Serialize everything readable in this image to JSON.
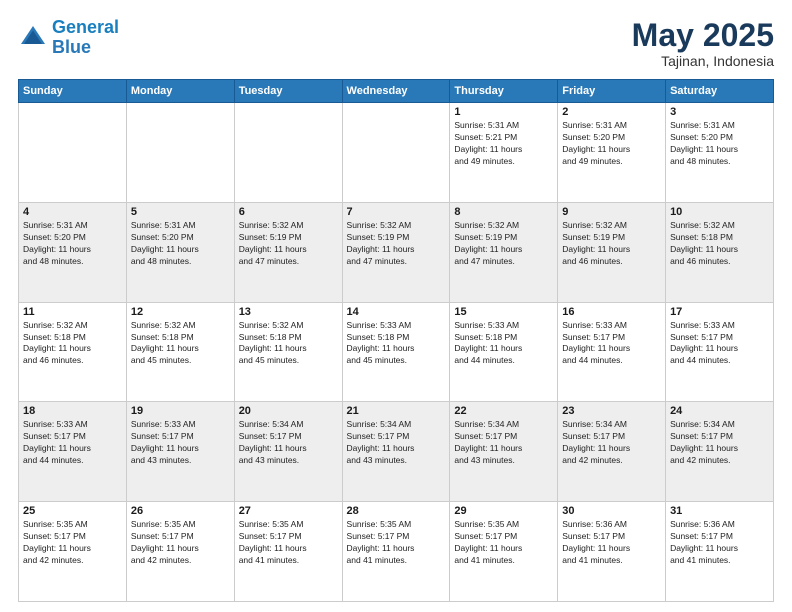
{
  "header": {
    "logo_general": "General",
    "logo_blue": "Blue",
    "month_title": "May 2025",
    "subtitle": "Tajinan, Indonesia"
  },
  "days_of_week": [
    "Sunday",
    "Monday",
    "Tuesday",
    "Wednesday",
    "Thursday",
    "Friday",
    "Saturday"
  ],
  "weeks": [
    [
      {
        "day": "",
        "info": ""
      },
      {
        "day": "",
        "info": ""
      },
      {
        "day": "",
        "info": ""
      },
      {
        "day": "",
        "info": ""
      },
      {
        "day": "1",
        "info": "Sunrise: 5:31 AM\nSunset: 5:21 PM\nDaylight: 11 hours\nand 49 minutes."
      },
      {
        "day": "2",
        "info": "Sunrise: 5:31 AM\nSunset: 5:20 PM\nDaylight: 11 hours\nand 49 minutes."
      },
      {
        "day": "3",
        "info": "Sunrise: 5:31 AM\nSunset: 5:20 PM\nDaylight: 11 hours\nand 48 minutes."
      }
    ],
    [
      {
        "day": "4",
        "info": "Sunrise: 5:31 AM\nSunset: 5:20 PM\nDaylight: 11 hours\nand 48 minutes."
      },
      {
        "day": "5",
        "info": "Sunrise: 5:31 AM\nSunset: 5:20 PM\nDaylight: 11 hours\nand 48 minutes."
      },
      {
        "day": "6",
        "info": "Sunrise: 5:32 AM\nSunset: 5:19 PM\nDaylight: 11 hours\nand 47 minutes."
      },
      {
        "day": "7",
        "info": "Sunrise: 5:32 AM\nSunset: 5:19 PM\nDaylight: 11 hours\nand 47 minutes."
      },
      {
        "day": "8",
        "info": "Sunrise: 5:32 AM\nSunset: 5:19 PM\nDaylight: 11 hours\nand 47 minutes."
      },
      {
        "day": "9",
        "info": "Sunrise: 5:32 AM\nSunset: 5:19 PM\nDaylight: 11 hours\nand 46 minutes."
      },
      {
        "day": "10",
        "info": "Sunrise: 5:32 AM\nSunset: 5:18 PM\nDaylight: 11 hours\nand 46 minutes."
      }
    ],
    [
      {
        "day": "11",
        "info": "Sunrise: 5:32 AM\nSunset: 5:18 PM\nDaylight: 11 hours\nand 46 minutes."
      },
      {
        "day": "12",
        "info": "Sunrise: 5:32 AM\nSunset: 5:18 PM\nDaylight: 11 hours\nand 45 minutes."
      },
      {
        "day": "13",
        "info": "Sunrise: 5:32 AM\nSunset: 5:18 PM\nDaylight: 11 hours\nand 45 minutes."
      },
      {
        "day": "14",
        "info": "Sunrise: 5:33 AM\nSunset: 5:18 PM\nDaylight: 11 hours\nand 45 minutes."
      },
      {
        "day": "15",
        "info": "Sunrise: 5:33 AM\nSunset: 5:18 PM\nDaylight: 11 hours\nand 44 minutes."
      },
      {
        "day": "16",
        "info": "Sunrise: 5:33 AM\nSunset: 5:17 PM\nDaylight: 11 hours\nand 44 minutes."
      },
      {
        "day": "17",
        "info": "Sunrise: 5:33 AM\nSunset: 5:17 PM\nDaylight: 11 hours\nand 44 minutes."
      }
    ],
    [
      {
        "day": "18",
        "info": "Sunrise: 5:33 AM\nSunset: 5:17 PM\nDaylight: 11 hours\nand 44 minutes."
      },
      {
        "day": "19",
        "info": "Sunrise: 5:33 AM\nSunset: 5:17 PM\nDaylight: 11 hours\nand 43 minutes."
      },
      {
        "day": "20",
        "info": "Sunrise: 5:34 AM\nSunset: 5:17 PM\nDaylight: 11 hours\nand 43 minutes."
      },
      {
        "day": "21",
        "info": "Sunrise: 5:34 AM\nSunset: 5:17 PM\nDaylight: 11 hours\nand 43 minutes."
      },
      {
        "day": "22",
        "info": "Sunrise: 5:34 AM\nSunset: 5:17 PM\nDaylight: 11 hours\nand 43 minutes."
      },
      {
        "day": "23",
        "info": "Sunrise: 5:34 AM\nSunset: 5:17 PM\nDaylight: 11 hours\nand 42 minutes."
      },
      {
        "day": "24",
        "info": "Sunrise: 5:34 AM\nSunset: 5:17 PM\nDaylight: 11 hours\nand 42 minutes."
      }
    ],
    [
      {
        "day": "25",
        "info": "Sunrise: 5:35 AM\nSunset: 5:17 PM\nDaylight: 11 hours\nand 42 minutes."
      },
      {
        "day": "26",
        "info": "Sunrise: 5:35 AM\nSunset: 5:17 PM\nDaylight: 11 hours\nand 42 minutes."
      },
      {
        "day": "27",
        "info": "Sunrise: 5:35 AM\nSunset: 5:17 PM\nDaylight: 11 hours\nand 41 minutes."
      },
      {
        "day": "28",
        "info": "Sunrise: 5:35 AM\nSunset: 5:17 PM\nDaylight: 11 hours\nand 41 minutes."
      },
      {
        "day": "29",
        "info": "Sunrise: 5:35 AM\nSunset: 5:17 PM\nDaylight: 11 hours\nand 41 minutes."
      },
      {
        "day": "30",
        "info": "Sunrise: 5:36 AM\nSunset: 5:17 PM\nDaylight: 11 hours\nand 41 minutes."
      },
      {
        "day": "31",
        "info": "Sunrise: 5:36 AM\nSunset: 5:17 PM\nDaylight: 11 hours\nand 41 minutes."
      }
    ]
  ]
}
